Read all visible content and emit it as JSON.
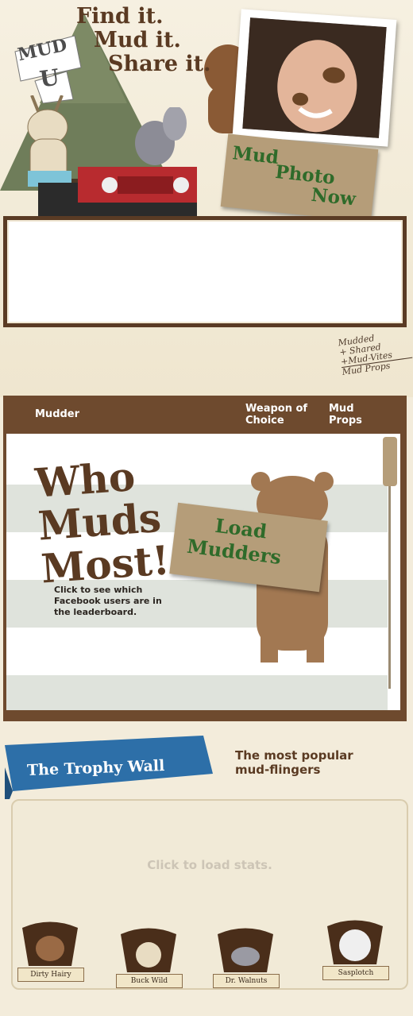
{
  "header": {
    "tagline": [
      "Find it.",
      "Mud it.",
      "Share it."
    ],
    "logo_text": [
      "MUD",
      "U"
    ],
    "mud_photo_button": [
      "Mud",
      "Photo",
      "Now"
    ]
  },
  "handwritten_note": [
    "Mudded",
    "+ Shared",
    "+Mud-Vites",
    "Mud Props"
  ],
  "leaderboard": {
    "columns": [
      "Mudder",
      "Weapon of Choice",
      "Mud Props"
    ],
    "headline": [
      "Who",
      "Muds",
      "Most!"
    ],
    "description": "Click to see which Facebook users are in the leaderboard.",
    "load_button": [
      "Load",
      "Mudders"
    ]
  },
  "trophy_wall": {
    "title": "The Trophy Wall",
    "subtitle": [
      "The most popular",
      "mud-flingers"
    ],
    "placeholder": "Click to load stats.",
    "trophies": [
      "Dirty Hairy",
      "Buck Wild",
      "Dr. Walnuts",
      "Sasplotch"
    ]
  },
  "colors": {
    "brown": "#5a3a22",
    "wood": "#6e4a2e",
    "green_text": "#2f6b2a",
    "cardboard": "#b59d79",
    "ribbon": "#2d6fa8"
  }
}
